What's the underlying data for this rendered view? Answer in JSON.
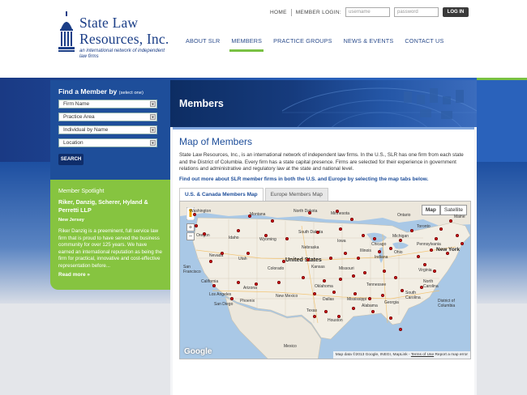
{
  "header": {
    "logo": {
      "line1": "State Law",
      "line2": "Resources, Inc.",
      "tagline": "an international network of independent law firms"
    },
    "utility": {
      "home": "HOME",
      "member_login": "MEMBER LOGIN:",
      "username_placeholder": "username",
      "password_placeholder": "password",
      "login_button": "LOG IN"
    },
    "nav": [
      {
        "label": "ABOUT SLR",
        "active": false
      },
      {
        "label": "MEMBERS",
        "active": true
      },
      {
        "label": "PRACTICE GROUPS",
        "active": false
      },
      {
        "label": "NEWS & EVENTS",
        "active": false
      },
      {
        "label": "CONTACT US",
        "active": false
      }
    ]
  },
  "sidebar": {
    "find_title": "Find a Member by",
    "find_hint": "(select one)",
    "selects": [
      "Firm Name",
      "Practice Area",
      "Individual by Name",
      "Location"
    ],
    "search_button": "SEARCH",
    "spotlight": {
      "heading": "Member Spotlight",
      "firm": "Riker, Danzig, Scherer, Hyland & Perretti LLP",
      "location": "New Jersey",
      "body": "Riker Danzig is a preeminent, full service law firm that is proud to have served the business community for over 125 years. We have earned an international reputation as being the firm for practical, innovative and cost-effective representation before...",
      "more": "Read more »"
    }
  },
  "page": {
    "title": "Members",
    "map_title": "Map of Members",
    "intro": "State Law Resources, Inc., is an international network of independent law firms. In the U.S., SLR has one firm from each state and the District of Columbia. Every firm has a state capital presence. Firms are selected for their experience in government relations and administrative and regulatory law at the state and national level.",
    "cta": "Find out more about SLR member firms in both the U.S. and Europe by selecting the map tabs below.",
    "tabs": [
      {
        "label": "U.S. & Canada Members Map",
        "active": true
      },
      {
        "label": "Europe Members Map",
        "active": false
      }
    ]
  },
  "map": {
    "type_buttons": [
      "Map",
      "Satellite"
    ],
    "zoom_in": "+",
    "zoom_out": "−",
    "google": "Google",
    "attribution": "Map data ©2013 Google, INEGI, MapLink",
    "terms": "Terms of Use",
    "report": "Report a map error",
    "labels": {
      "washington": "Washington",
      "montana": "Montana",
      "north_dakota": "North Dakota",
      "minnesota": "Minnesota",
      "oregon": "Oregon",
      "idaho": "Idaho",
      "wyoming": "Wyoming",
      "south_dakota": "South Dakota",
      "iowa": "Iowa",
      "nevada": "Nevada",
      "utah": "Utah",
      "colorado": "Colorado",
      "nebraska": "Nebraska",
      "kansas": "Kansas",
      "united_states": "United States",
      "missouri": "Missouri",
      "illinois": "Illinois",
      "indiana": "Indiana",
      "ohio": "Ohio",
      "chicago": "Chicago",
      "san_francisco": "San\nFrancisco",
      "california": "California",
      "arizona": "Arizona",
      "new_mexico": "New Mexico",
      "oklahoma": "Oklahoma",
      "tennessee": "Tennessee",
      "los_angeles": "Los Angeles",
      "san_diego": "San Diego",
      "phoenix": "Phoenix",
      "dallas": "Dallas",
      "texas": "Texas",
      "mississippi": "Mississippi",
      "alabama": "Alabama",
      "georgia": "Georgia",
      "houston": "Houston",
      "toronto": "Toronto",
      "michigan": "Michigan",
      "new_york": "New York",
      "pennsylvania": "Pennsylvania",
      "virginia": "Virginia",
      "north_carolina": "North\nCarolina",
      "south_carolina": "South\nCarolina",
      "mexico": "Mexico",
      "maine": "Maine",
      "district_of_columbia": "District of\nColumbia",
      "ontario": "Ontario"
    },
    "colors": {
      "water": "#a9c8e6",
      "land": "#efeae0",
      "pin": "#e3141b"
    }
  }
}
